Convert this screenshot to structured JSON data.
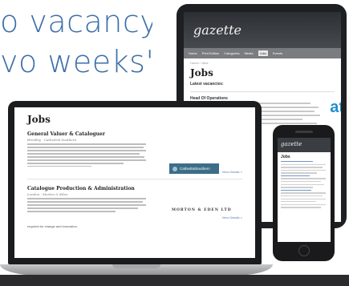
{
  "headline": {
    "line1": "o vacancy",
    "line2": "vo weeks'"
  },
  "tablet": {
    "logo": "gazette",
    "nav": [
      "Home",
      "Print Edition",
      "Categories",
      "Media",
      "Jobs",
      "Events"
    ],
    "breadcrumb": "Home / Jobs",
    "title": "Jobs",
    "subtitle": "Latest vacancies:",
    "job_title": "Head Of Operations",
    "badge_text": "at"
  },
  "laptop": {
    "title": "Jobs",
    "jobs": [
      {
        "title": "General Valuer & Cataloguer",
        "location": "Brindley · Cathedral Southern",
        "logo": "CathedralSouthern",
        "view": "View Details >"
      },
      {
        "title": "Catalogue Production & Administration",
        "location": "London · Morton & Eden",
        "logo": "MORTON & EDEN LTD",
        "view": "View Details >"
      }
    ],
    "footer": "required for change and innovation."
  },
  "phone": {
    "logo": "gazette",
    "title": "Jobs"
  }
}
